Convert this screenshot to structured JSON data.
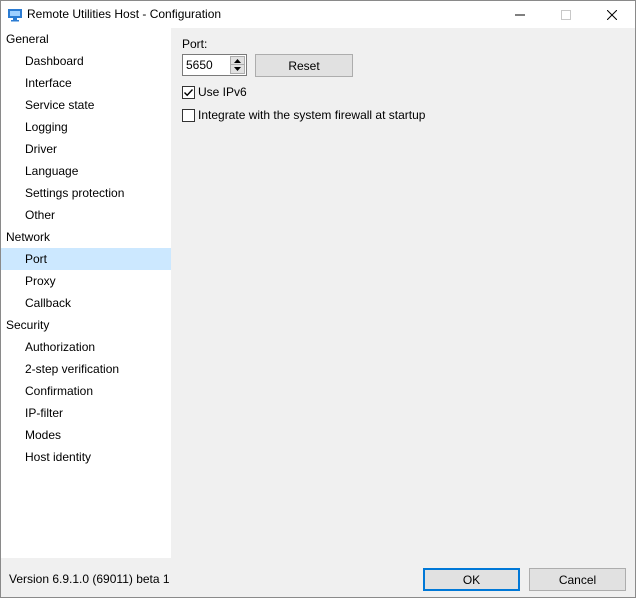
{
  "window": {
    "title": "Remote Utilities Host - Configuration",
    "icon": "monitor-icon"
  },
  "sidebar": {
    "groups": [
      {
        "label": "General",
        "items": [
          "Dashboard",
          "Interface",
          "Service state",
          "Logging",
          "Driver",
          "Language",
          "Settings protection",
          "Other"
        ]
      },
      {
        "label": "Network",
        "items": [
          "Port",
          "Proxy",
          "Callback"
        ]
      },
      {
        "label": "Security",
        "items": [
          "Authorization",
          "2-step verification",
          "Confirmation",
          "IP-filter",
          "Modes",
          "Host identity"
        ]
      }
    ],
    "selected": "Port",
    "selected_color": "#cce8ff"
  },
  "port": {
    "label": "Port:",
    "value": "5650",
    "reset_label": "Reset",
    "use_ipv6": {
      "label": "Use IPv6",
      "checked": true
    },
    "firewall": {
      "label": "Integrate with the system firewall at startup",
      "checked": false
    }
  },
  "footer": {
    "version": "Version 6.9.1.0 (69011) beta 1",
    "ok_label": "OK",
    "cancel_label": "Cancel",
    "accent": "#0078d7"
  }
}
